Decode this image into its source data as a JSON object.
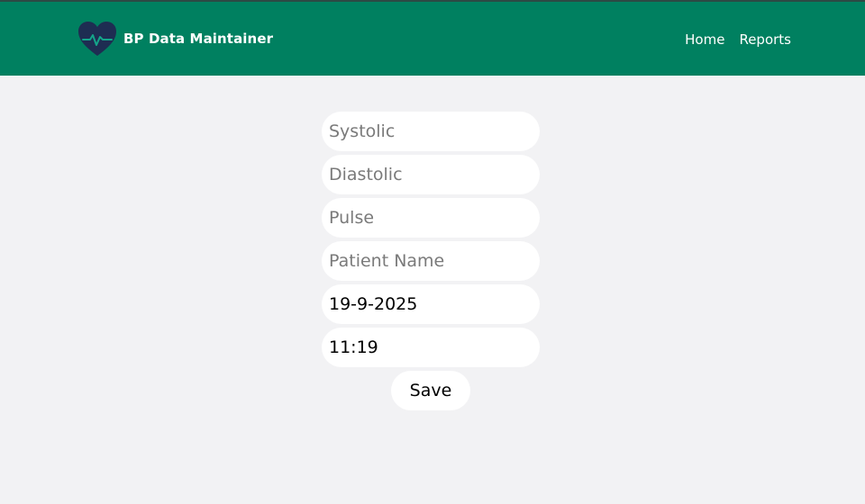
{
  "header": {
    "title": "BP Data Maintainer",
    "logo_icon": "heart-pulse-icon",
    "background_color": "#008060",
    "nav": {
      "home_label": "Home",
      "reports_label": "Reports"
    }
  },
  "form": {
    "systolic": {
      "placeholder": "Systolic",
      "value": ""
    },
    "diastolic": {
      "placeholder": "Diastolic",
      "value": ""
    },
    "pulse": {
      "placeholder": "Pulse",
      "value": ""
    },
    "patient_name": {
      "placeholder": "Patient Name",
      "value": ""
    },
    "date": {
      "value": "19-9-2025"
    },
    "time": {
      "value": "11:19"
    },
    "save_label": "Save"
  }
}
